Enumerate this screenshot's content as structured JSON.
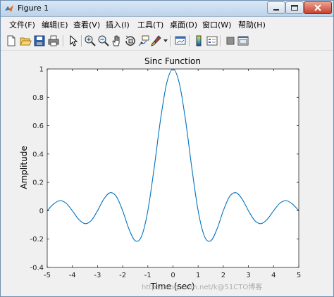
{
  "window": {
    "title": "Figure 1"
  },
  "menu": [
    "文件(F)",
    "编辑(E)",
    "查看(V)",
    "插入(I)",
    "工具(T)",
    "桌面(D)",
    "窗口(W)",
    "帮助(H)"
  ],
  "toolbar_icons": [
    "new-figure-icon",
    "open-file-icon",
    "save-icon",
    "print-icon",
    "edit-plot-arrow-icon",
    "zoom-in-icon",
    "zoom-out-icon",
    "pan-hand-icon",
    "rotate-3d-icon",
    "data-cursor-icon",
    "brush-icon",
    "link-plot-icon",
    "colorbar-icon",
    "legend-icon",
    "hide-plot-tools-icon",
    "show-plot-tools-icon"
  ],
  "chart_data": {
    "type": "line",
    "title": "Sinc Function",
    "xlabel": "Time (sec)",
    "ylabel": "Amplitude",
    "xlim": [
      -5,
      5
    ],
    "ylim": [
      -0.4,
      1
    ],
    "xticks": [
      "-5",
      "-4",
      "-3",
      "-2",
      "-1",
      "0",
      "1",
      "2",
      "3",
      "4",
      "5"
    ],
    "yticks": [
      "-0.4",
      "-0.2",
      "0",
      "0.2",
      "0.4",
      "0.6",
      "0.8",
      "1"
    ],
    "grid": false,
    "series": [
      {
        "color": "#0072bd",
        "x": [
          -5,
          -4.75,
          -4.5,
          -4.25,
          -4,
          -3.75,
          -3.5,
          -3.25,
          -3,
          -2.75,
          -2.5,
          -2.25,
          -2,
          -1.75,
          -1.5,
          -1.25,
          -1,
          -0.75,
          -0.5,
          -0.25,
          0,
          0.25,
          0.5,
          0.75,
          1,
          1.25,
          1.5,
          1.75,
          2,
          2.25,
          2.5,
          2.75,
          3,
          3.25,
          3.5,
          3.75,
          4,
          4.25,
          4.5,
          4.75,
          5
        ],
        "y": [
          0,
          0.047,
          0.071,
          0.053,
          0,
          -0.06,
          -0.091,
          -0.069,
          0,
          0.082,
          0.127,
          0.1,
          0,
          -0.129,
          -0.212,
          -0.18,
          0,
          0.3,
          0.637,
          0.9,
          1,
          0.9,
          0.637,
          0.3,
          0,
          -0.18,
          -0.212,
          -0.129,
          0,
          0.1,
          0.127,
          0.082,
          0,
          -0.069,
          -0.091,
          -0.06,
          0,
          0.053,
          0.071,
          0.047,
          0
        ]
      }
    ]
  },
  "watermark": "http://blog.csdn.net/k@51CTO博客"
}
